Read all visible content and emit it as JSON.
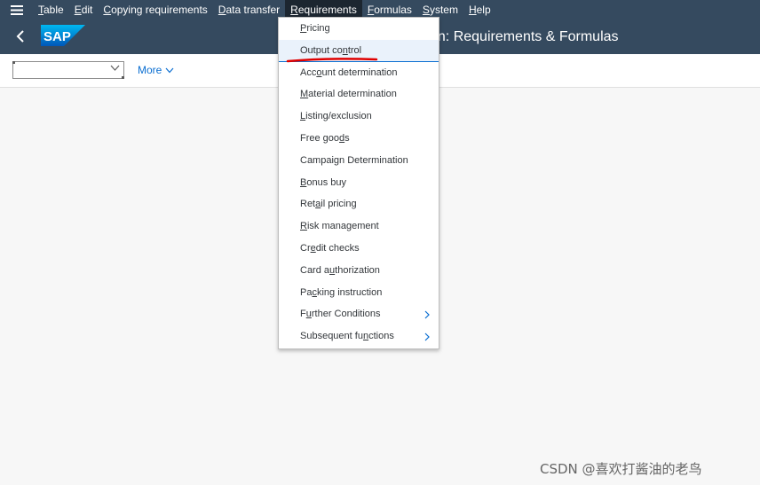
{
  "menubar": {
    "items": [
      {
        "pre": "",
        "ul": "T",
        "post": "able"
      },
      {
        "pre": "",
        "ul": "E",
        "post": "dit"
      },
      {
        "pre": "",
        "ul": "C",
        "post": "opying requirements"
      },
      {
        "pre": "",
        "ul": "D",
        "post": "ata transfer"
      },
      {
        "pre": "",
        "ul": "R",
        "post": "equirements"
      },
      {
        "pre": "",
        "ul": "F",
        "post": "ormulas"
      },
      {
        "pre": "",
        "ul": "S",
        "post": "ystem"
      },
      {
        "pre": "",
        "ul": "H",
        "post": "elp"
      }
    ]
  },
  "shell": {
    "title": "tain: Requirements & Formulas",
    "logo_text": "SAP"
  },
  "toolbar": {
    "combo_value": "",
    "more_label": "More"
  },
  "dropdown": {
    "items": [
      {
        "pre": "",
        "ul": "P",
        "post": "ricing"
      },
      {
        "pre": "Output co",
        "ul": "n",
        "post": "trol"
      },
      {
        "pre": "Acc",
        "ul": "o",
        "post": "unt determination"
      },
      {
        "pre": "",
        "ul": "M",
        "post": "aterial determination"
      },
      {
        "pre": "",
        "ul": "L",
        "post": "isting/exclusion"
      },
      {
        "pre": "Free goo",
        "ul": "d",
        "post": "s"
      },
      {
        "pre": "Campai",
        "ul": "g",
        "post": "n Determination"
      },
      {
        "pre": "",
        "ul": "B",
        "post": "onus buy"
      },
      {
        "pre": "Ret",
        "ul": "a",
        "post": "il pricing"
      },
      {
        "pre": "",
        "ul": "R",
        "post": "isk management"
      },
      {
        "pre": "Cr",
        "ul": "e",
        "post": "dit checks"
      },
      {
        "pre": "Card a",
        "ul": "u",
        "post": "thorization"
      },
      {
        "pre": "Pa",
        "ul": "c",
        "post": "king instruction"
      },
      {
        "pre": "F",
        "ul": "u",
        "post": "rther Conditions"
      },
      {
        "pre": "Subsequent fu",
        "ul": "n",
        "post": "ctions"
      }
    ]
  },
  "watermark": "CSDN @喜欢打酱油的老鸟",
  "colors": {
    "shell_bg": "#354a5f",
    "active_menu": "#1c2630",
    "link": "#0a6ed1",
    "annotation": "#e00000"
  }
}
